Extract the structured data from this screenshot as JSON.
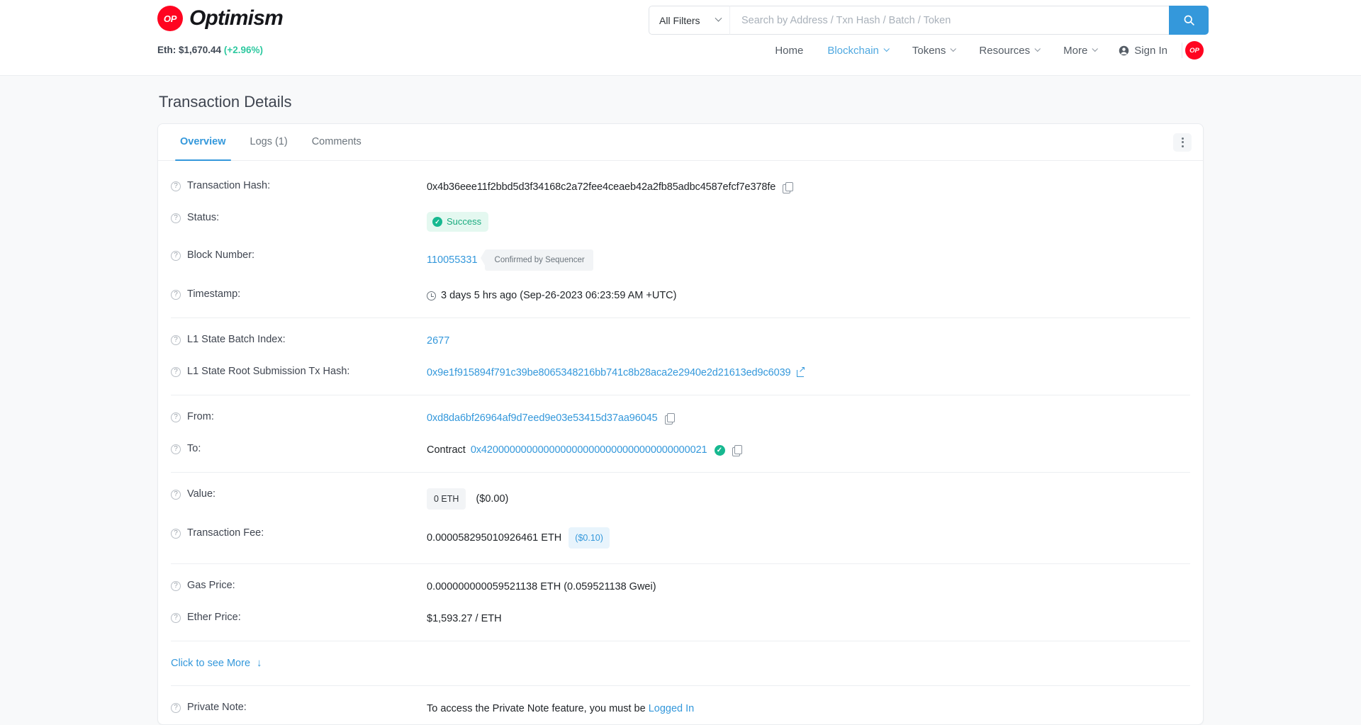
{
  "header": {
    "brand": {
      "logo_text": "OP",
      "name": "Optimism"
    },
    "eth_price_label": "Eth: $1,670.44",
    "eth_price_change": "(+2.96%)",
    "search": {
      "filter_label": "All Filters",
      "placeholder": "Search by Address / Txn Hash / Batch / Token",
      "value": ""
    },
    "nav": [
      {
        "label": "Home",
        "caret": false,
        "active": false
      },
      {
        "label": "Blockchain",
        "caret": true,
        "active": true
      },
      {
        "label": "Tokens",
        "caret": true,
        "active": false
      },
      {
        "label": "Resources",
        "caret": true,
        "active": false
      },
      {
        "label": "More",
        "caret": true,
        "active": false
      }
    ],
    "sign_in_label": "Sign In",
    "avatar_text": "OP"
  },
  "page": {
    "title": "Transaction Details",
    "tabs": [
      {
        "label": "Overview",
        "active": true
      },
      {
        "label": "Logs (1)",
        "active": false
      },
      {
        "label": "Comments",
        "active": false
      }
    ]
  },
  "tx": {
    "hash_label": "Transaction Hash:",
    "hash_value": "0x4b36eee11f2bbd5d3f34168c2a72fee4ceaeb42a2fb85adbc4587efcf7e378fe",
    "status_label": "Status:",
    "status_value": "Success",
    "block_label": "Block Number:",
    "block_value": "110055331",
    "block_badge": "Confirmed by Sequencer",
    "timestamp_label": "Timestamp:",
    "timestamp_value": "3 days 5 hrs ago (Sep-26-2023 06:23:59 AM +UTC)",
    "batch_index_label": "L1 State Batch Index:",
    "batch_index_value": "2677",
    "l1_root_label": "L1 State Root Submission Tx Hash:",
    "l1_root_value": "0x9e1f915894f791c39be8065348216bb741c8b28aca2e2940e2d21613ed9c6039",
    "from_label": "From:",
    "from_value": "0xd8da6bf26964af9d7eed9e03e53415d37aa96045",
    "to_label": "To:",
    "to_prefix": "Contract",
    "to_value": "0x4200000000000000000000000000000000000021",
    "value_label": "Value:",
    "value_eth": "0 ETH",
    "value_usd": "($0.00)",
    "fee_label": "Transaction Fee:",
    "fee_eth": "0.000058295010926461 ETH",
    "fee_usd": "($0.10)",
    "gas_price_label": "Gas Price:",
    "gas_price_value": "0.000000000059521138 ETH (0.059521138 Gwei)",
    "ether_price_label": "Ether Price:",
    "ether_price_value": "$1,593.27 / ETH",
    "see_more_label": "Click to see More",
    "private_note_label": "Private Note:",
    "private_note_text": "To access the Private Note feature, you must be",
    "private_note_link": "Logged In"
  },
  "icons": {
    "help": "?",
    "check": "✓"
  },
  "colors": {
    "accent": "#3498db",
    "brand_red": "#ff0420",
    "success": "#17b890"
  }
}
